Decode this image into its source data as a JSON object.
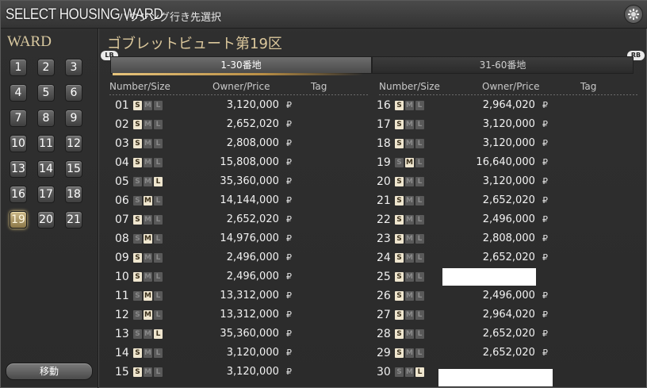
{
  "window": {
    "title": "SELECT HOUSING WARD",
    "subtitle": "ハウジング行き先選択",
    "close_icon": "gear-close-icon"
  },
  "sidebar": {
    "label": "WARD",
    "wards": [
      "1",
      "2",
      "3",
      "4",
      "5",
      "6",
      "7",
      "8",
      "9",
      "10",
      "11",
      "12",
      "13",
      "14",
      "15",
      "16",
      "17",
      "18",
      "19",
      "20",
      "21"
    ],
    "selected": "19",
    "move_button": "移動"
  },
  "main": {
    "ward_title": "ゴブレットビュート第19区",
    "tabs": [
      {
        "label": "1-30番地",
        "active": true
      },
      {
        "label": "31-60番地",
        "active": false
      }
    ],
    "lb_label": "LB",
    "rb_label": "RB",
    "columns": {
      "number_size": "Number/Size",
      "owner_price": "Owner/Price",
      "tag": "Tag"
    },
    "currency": "₽",
    "size_letters": [
      "S",
      "M",
      "L"
    ],
    "plots_left": [
      {
        "num": "01",
        "size": "S",
        "price": "3,120,000"
      },
      {
        "num": "02",
        "size": "S",
        "price": "2,652,020"
      },
      {
        "num": "03",
        "size": "S",
        "price": "2,808,000"
      },
      {
        "num": "04",
        "size": "S",
        "price": "15,808,000"
      },
      {
        "num": "05",
        "size": "L",
        "price": "35,360,000"
      },
      {
        "num": "06",
        "size": "M",
        "price": "14,144,000"
      },
      {
        "num": "07",
        "size": "S",
        "price": "2,652,020"
      },
      {
        "num": "08",
        "size": "M",
        "price": "14,976,000"
      },
      {
        "num": "09",
        "size": "S",
        "price": "2,496,000"
      },
      {
        "num": "10",
        "size": "S",
        "price": "2,496,000"
      },
      {
        "num": "11",
        "size": "M",
        "price": "13,312,000"
      },
      {
        "num": "12",
        "size": "M",
        "price": "13,312,000"
      },
      {
        "num": "13",
        "size": "L",
        "price": "35,360,000"
      },
      {
        "num": "14",
        "size": "S",
        "price": "3,120,000"
      },
      {
        "num": "15",
        "size": "S",
        "price": "3,120,000"
      }
    ],
    "plots_right": [
      {
        "num": "16",
        "size": "S",
        "price": "2,964,020"
      },
      {
        "num": "17",
        "size": "S",
        "price": "3,120,000"
      },
      {
        "num": "18",
        "size": "S",
        "price": "3,120,000"
      },
      {
        "num": "19",
        "size": "M",
        "price": "16,640,000"
      },
      {
        "num": "20",
        "size": "S",
        "price": "3,120,000"
      },
      {
        "num": "21",
        "size": "S",
        "price": "2,652,020"
      },
      {
        "num": "22",
        "size": "S",
        "price": "2,496,000"
      },
      {
        "num": "23",
        "size": "S",
        "price": "2,808,000"
      },
      {
        "num": "24",
        "size": "S",
        "price": "2,652,020"
      },
      {
        "num": "25",
        "size": "S",
        "price": null
      },
      {
        "num": "26",
        "size": "S",
        "price": "2,496,000"
      },
      {
        "num": "27",
        "size": "S",
        "price": "2,964,020"
      },
      {
        "num": "28",
        "size": "S",
        "price": "2,652,020"
      },
      {
        "num": "29",
        "size": "S",
        "price": "2,652,020"
      },
      {
        "num": "30",
        "size": "L",
        "price": null
      }
    ]
  }
}
